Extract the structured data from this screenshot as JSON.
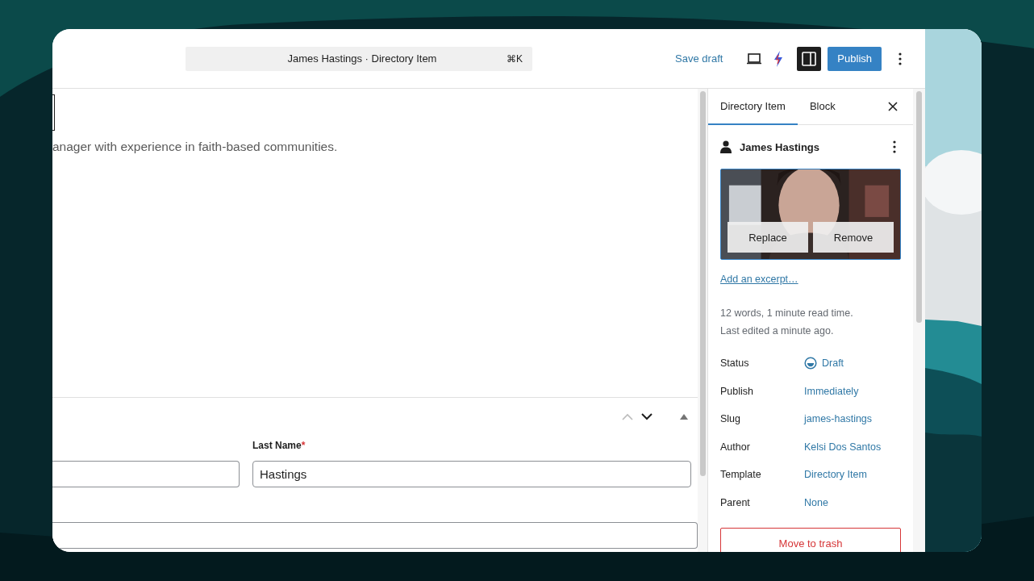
{
  "top_bar": {
    "command_center": {
      "title": "James Hastings · Directory Item",
      "shortcut": "⌘K"
    },
    "save_draft": "Save draft",
    "sidebar_toggle": {
      "on": true
    },
    "publish": "Publish"
  },
  "canvas": {
    "paragraph": "anager with experience in faith-based communities.",
    "metabox": {
      "move_up": {
        "disabled": true
      },
      "move_down": {
        "disabled": false
      },
      "fields": [
        {
          "kind": "half"
        },
        {
          "kind": "half",
          "label": "Last Name",
          "required_mark": "*",
          "value": "Hastings"
        },
        {
          "kind": "full"
        }
      ]
    }
  },
  "sidebar": {
    "tabs": [
      {
        "label": "Directory Item",
        "selected": true
      },
      {
        "label": "Block",
        "selected": false
      }
    ],
    "post_title": "James Hastings",
    "featured_image": {
      "kind": "picture",
      "buttons": [
        "Replace",
        "Remove"
      ]
    },
    "excerpt_link": "Add an excerpt…",
    "stats": [
      "12 words, 1 minute read time.",
      "Last edited a minute ago."
    ],
    "summary": [
      {
        "label": "Status",
        "value": "Draft",
        "kind": "status"
      },
      {
        "label": "Publish",
        "value": "Immediately",
        "kind": "link"
      },
      {
        "label": "Slug",
        "value": "james-hastings",
        "kind": "link"
      },
      {
        "label": "Author",
        "value": "Kelsi Dos Santos",
        "kind": "link"
      },
      {
        "label": "Template",
        "value": "Directory Item",
        "kind": "link"
      },
      {
        "label": "Parent",
        "value": "None",
        "kind": "link"
      }
    ],
    "trash_button": "Move to trash"
  }
}
